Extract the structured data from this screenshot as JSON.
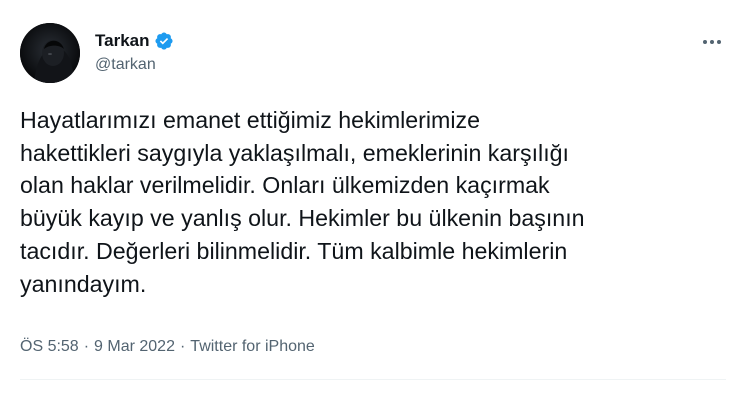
{
  "author": {
    "name": "Tarkan",
    "handle": "@tarkan",
    "verified": true
  },
  "tweet": {
    "text": "Hayatlarımızı emanet ettiğimiz hekimlerimize\nhakettikleri saygıyla yaklaşılmalı, emeklerinin karşılığı\nolan haklar verilmelidir. Onları ülkemizden kaçırmak\nbüyük kayıp ve yanlış olur. Hekimler bu ülkenin başının\ntacıdır. Değerleri bilinmelidir. Tüm kalbimle hekimlerin\nyanındayım."
  },
  "meta": {
    "time": "ÖS 5:58",
    "separator": "·",
    "date": "9 Mar 2022",
    "source": "Twitter for iPhone"
  },
  "icons": {
    "verified": "verified-badge-icon",
    "more": "more-horizontal-icon"
  },
  "colors": {
    "text": "#0f1419",
    "secondary": "#536471",
    "verified": "#1d9bf0",
    "divider": "#eff3f4"
  }
}
